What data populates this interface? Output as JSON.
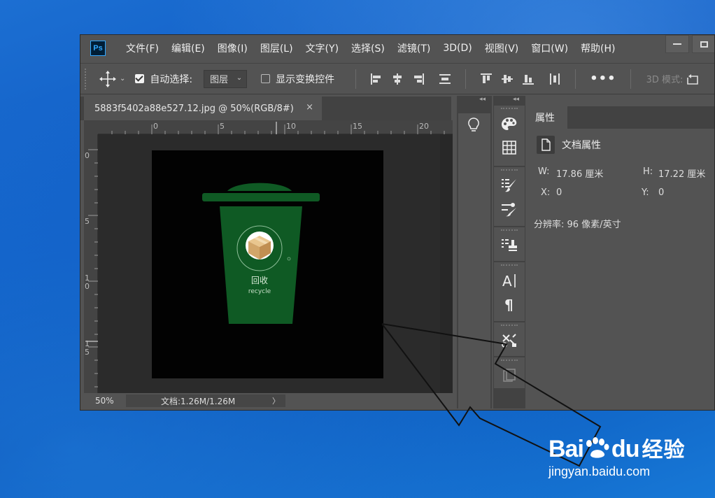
{
  "window": {
    "logo": "Ps",
    "menu": [
      "文件(F)",
      "编辑(E)",
      "图像(I)",
      "图层(L)",
      "文字(Y)",
      "选择(S)",
      "滤镜(T)",
      "3D(D)",
      "视图(V)",
      "窗口(W)",
      "帮助(H)"
    ]
  },
  "options": {
    "auto_select_label": "自动选择:",
    "auto_select_checked": true,
    "auto_select_target": "图层",
    "show_transform_label": "显示变换控件",
    "show_transform_checked": false,
    "more_label": "•••",
    "threed_label": "3D 模式:"
  },
  "document": {
    "tab_title": "5883f5402a88e527.12.jpg @ 50%(RGB/8#)",
    "tab_close": "×",
    "ruler_top": [
      "0",
      "5",
      "10",
      "15",
      "20"
    ],
    "ruler_left": [
      "0",
      "5",
      "1\n0",
      "1\n5"
    ],
    "zoom": "50%",
    "doc_info": "文档:1.26M/1.26M",
    "doc_info_more": "〉"
  },
  "artwork": {
    "bin_label_cn": "回收",
    "bin_label_en": "recycle"
  },
  "properties": {
    "tab_label": "属性",
    "section_title": "文档属性",
    "w_label": "W:",
    "w_value": "17.86 厘米",
    "h_label": "H:",
    "h_value": "17.22 厘米",
    "x_label": "X:",
    "x_value": "0",
    "y_label": "Y:",
    "y_value": "0",
    "resolution": "分辨率: 96 像素/英寸"
  },
  "watermark": {
    "logo_a": "Bai",
    "logo_b": "du",
    "logo_c": "经验",
    "url": "jingyan.baidu.com"
  },
  "colors": {
    "ps_blue": "#31a8ff",
    "bin_green": "#0f5a24",
    "panel": "#535353"
  }
}
